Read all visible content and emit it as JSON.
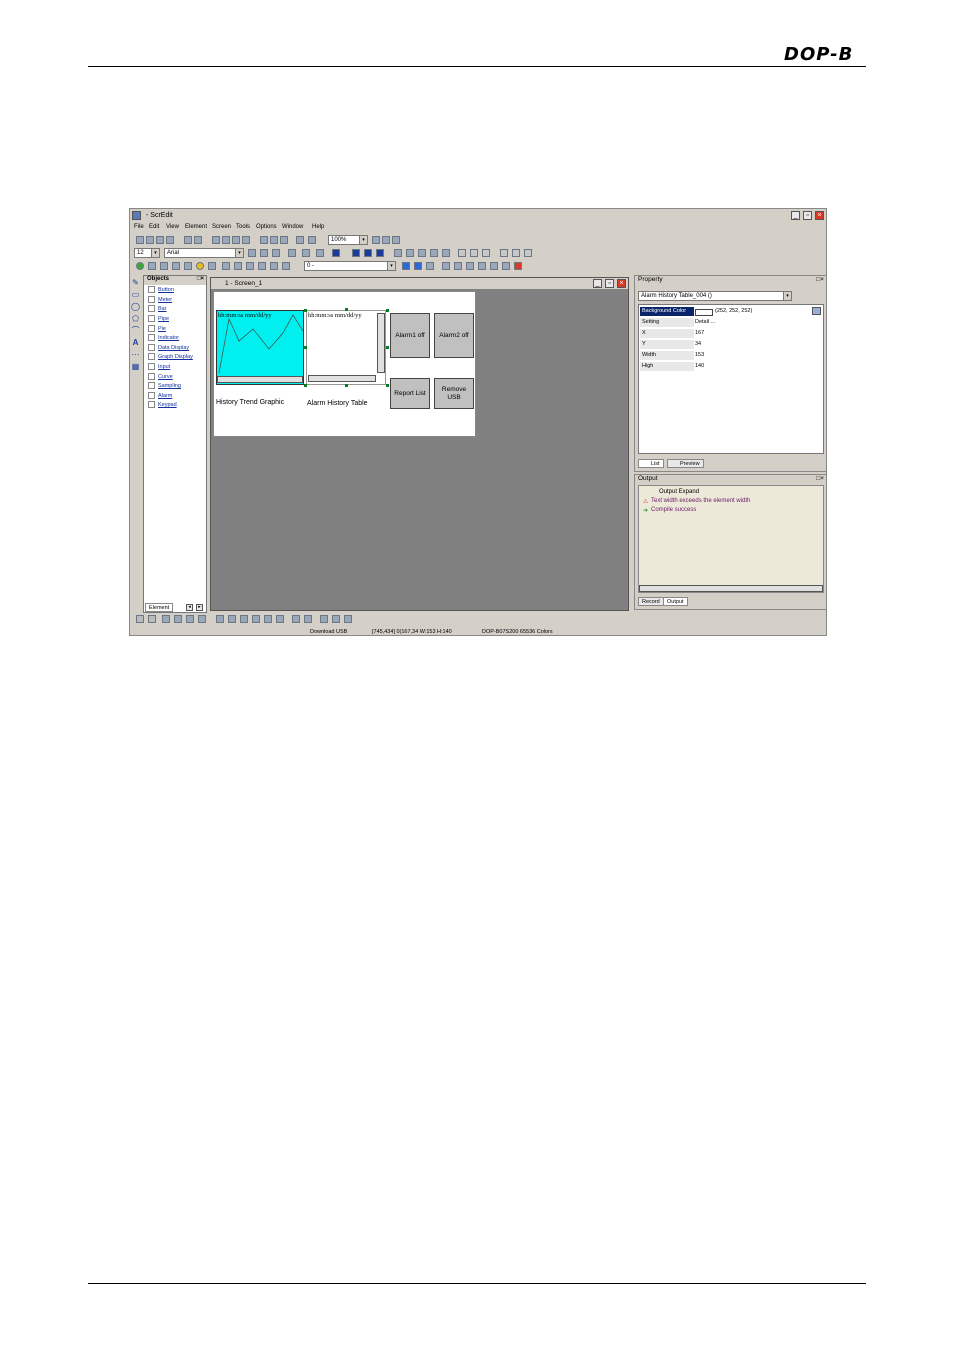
{
  "header": {
    "logo": "DOP-B"
  },
  "app": {
    "title": "- ScrEdit",
    "menu": [
      "File",
      "Edit",
      "View",
      "Element",
      "Screen",
      "Tools",
      "Options",
      "Window",
      "Help"
    ],
    "zoom": "100%",
    "font_size": "12",
    "font_name": "Arial",
    "state_value": "0 -"
  },
  "objects_panel": {
    "title": "Objects",
    "items": [
      "Button",
      "Meter",
      "Bar",
      "Pipe",
      "Pie",
      "Indicator",
      "Data Display",
      "Graph Display",
      "Input",
      "Curve",
      "Sampling",
      "Alarm",
      "Keypad"
    ],
    "tab": "Element"
  },
  "screen_window": {
    "title": "1 - Screen_1",
    "trend_label": "hh:mm:ss mm/dd/yy",
    "alarm_table_label": "hh:mm:ss mm/dd/yy",
    "alarm1_button": "Alarm1 off",
    "alarm2_button": "Alarm2 off",
    "report_button": "Report List",
    "remove_button": "Remove USB",
    "trend_caption": "History Trend Graphic",
    "table_caption": "Alarm History Table"
  },
  "property_panel": {
    "title": "Property",
    "selected": "Alarm History Table_004 ()",
    "rows": [
      {
        "key": "Background Color",
        "value": "(252, 252, 252)"
      },
      {
        "key": "Setting",
        "value": "Detail ..."
      },
      {
        "key": "X",
        "value": "167"
      },
      {
        "key": "Y",
        "value": "34"
      },
      {
        "key": "Width",
        "value": "153"
      },
      {
        "key": "High",
        "value": "140"
      }
    ],
    "tab_list": "List",
    "tab_preview": "Preview"
  },
  "output_panel": {
    "title": "Output",
    "expand": "Output Expand",
    "lines": [
      "Text width exceeds the element width",
      "Compile success"
    ],
    "tab_record": "Record",
    "tab_output": "Output"
  },
  "status": {
    "left": "Download USB",
    "middle": "[745,434] 0(167,34  W:153 H:140",
    "right": "DOP-B07S200 65536 Colors"
  },
  "colors": {
    "trend_fill": "#00f0f0",
    "selection": "#0a246a"
  }
}
